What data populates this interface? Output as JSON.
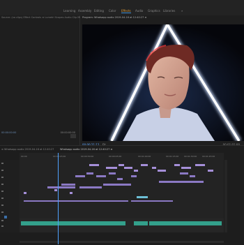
{
  "workspaces": [
    {
      "label": "Learning",
      "active": false
    },
    {
      "label": "Assembly",
      "active": false
    },
    {
      "label": "Editing",
      "active": false
    },
    {
      "label": "Color",
      "active": false
    },
    {
      "label": "Effects",
      "active": true
    },
    {
      "label": "Audio",
      "active": false
    },
    {
      "label": "Graphics",
      "active": false
    },
    {
      "label": "Libraries",
      "active": false
    },
    {
      "label": "»",
      "active": false
    }
  ],
  "source_panel": {
    "title": "Source: (no clips) Effect Controls ≡ Lumetri Scopes Audio Clip Mixer: Sequence (2019-04-16)",
    "timecode_left": "00:00:00:00",
    "timecode_right": "00:00:00:00"
  },
  "program_panel": {
    "title": "Program: Whatsapp audio 2019-04-16 at 12:40:27 ≡",
    "timecode": "00:00:21:12",
    "fit": "Fit",
    "duration": "00:01:01:00"
  },
  "timeline": {
    "tabs": [
      {
        "label": "≡ Whatsapp audio 2019-04-16 at 12:40:27",
        "active": false
      },
      {
        "label": "Whatsapp audio 2019-04-16 at 12:40:27 ≡",
        "active": true
      }
    ],
    "ruler": [
      "00:00",
      "00:00:15:00",
      "00:00:30:00",
      "00:00:45:00",
      "00:01:00:00",
      "00:01:15:00",
      "00:01:30:00",
      "00:01:45:00"
    ]
  },
  "colors": {
    "accent_blue": "#3d8fd6",
    "effects_tab": "#e6a23c",
    "video_clip": "#a58fd8",
    "audio_clip": "#33a08b",
    "playhead": "#4fa3ff"
  }
}
